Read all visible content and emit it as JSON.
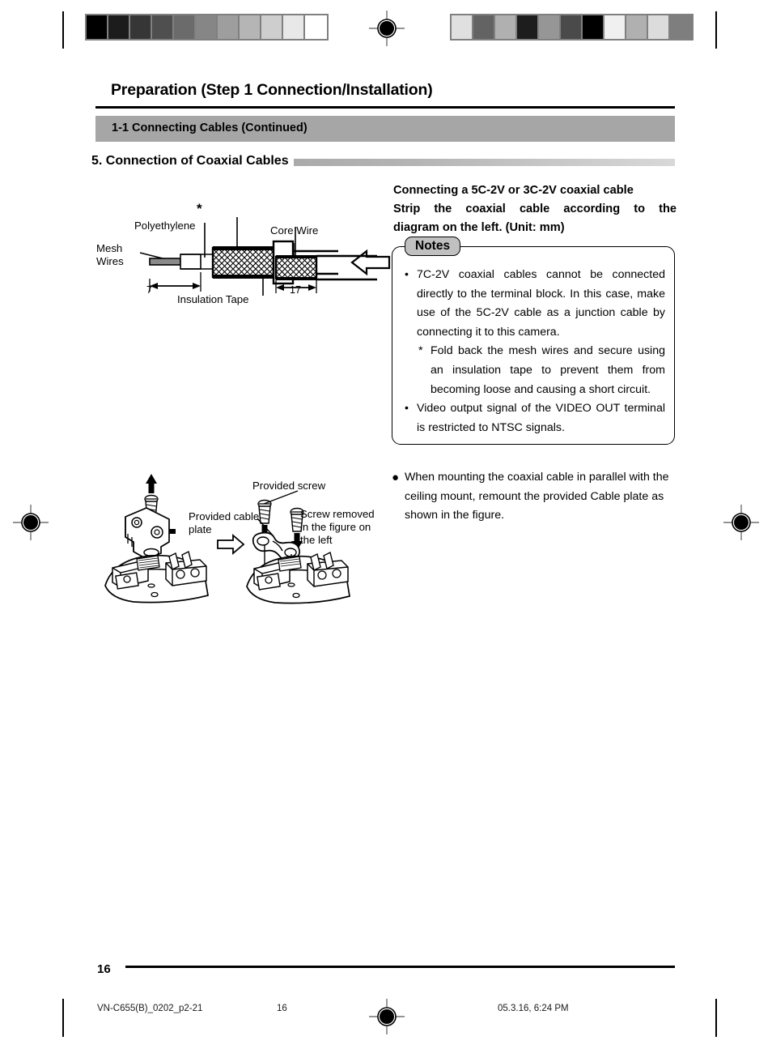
{
  "document": {
    "page_title": "Preparation (Step 1 Connection/Installation)",
    "subsection_band": "1-1 Connecting Cables (Continued)",
    "section_heading": "5.  Connection of Coaxial Cables",
    "page_number": "16"
  },
  "right_column": {
    "lead_line1": "Connecting a 5C-2V or 3C-2V coaxial cable",
    "lead_line2": "Strip the coaxial cable according to the",
    "lead_line3": "diagram on the left. (Unit: mm)",
    "notes_badge": "Notes",
    "notes": [
      {
        "marker": "•",
        "text": "7C-2V coaxial cables cannot be connected directly to the terminal block. In this case, make use of the 5C-2V cable as a junction cable by connecting it to this camera."
      },
      {
        "marker": "*",
        "text": "Fold back the mesh wires and secure using an insulation tape to prevent them from becoming loose and causing a short circuit."
      },
      {
        "marker": "•",
        "text": "Video output signal of the VIDEO OUT terminal is restricted to NTSC signals."
      }
    ],
    "lower_bullet": {
      "marker": "●",
      "text": "When mounting the coaxial cable in parallel with the ceiling mount, remount the provided Cable plate as shown in the figure."
    }
  },
  "cable_figure": {
    "asterisk": "*",
    "label_mesh_wires_line1": "Mesh",
    "label_mesh_wires_line2": "Wires",
    "label_polyethylene": "Polyethylene",
    "label_core_wire": "Core Wire",
    "label_insulation_tape": "Insulation Tape",
    "dimension_left": "7",
    "dimension_right": "17"
  },
  "plate_figure": {
    "label_provided_screw": "Provided screw",
    "label_provided_cable_line1": "Provided cable",
    "label_provided_cable_line2": "plate",
    "label_screw_removed_line1": "Screw removed",
    "label_screw_removed_line2": "in the figure on",
    "label_screw_removed_line3": "the left"
  },
  "footer": {
    "file_name": "VN-C655(B)_0202_p2-21",
    "page_ref": "16",
    "timestamp": "05.3.16, 6:24 PM"
  },
  "calibration": {
    "left_wedge": [
      "#000000",
      "#1c1c1c",
      "#363636",
      "#4f4f4f",
      "#6b6b6b",
      "#868686",
      "#9e9e9e",
      "#b5b5b5",
      "#cecece",
      "#e8e8e8",
      "#ffffff"
    ],
    "right_wedge": [
      "#e0e0e0",
      "#636363",
      "#b0b0b0",
      "#1d1d1d",
      "#969696",
      "#4a4a4a",
      "#000000",
      "#f0f0f0",
      "#b0b0b0",
      "#dcdcdc",
      "#7e7e7e"
    ]
  },
  "colors": {
    "band_gray": "#a6a6a6",
    "badge_gray": "#c0c0c0",
    "rule_black": "#000000"
  }
}
